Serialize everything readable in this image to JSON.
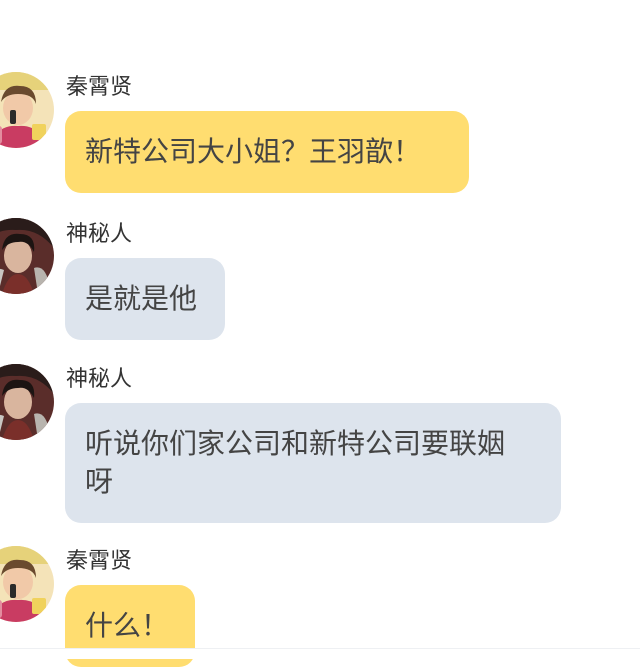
{
  "messages": [
    {
      "sender": "秦霄贤",
      "text": "新特公司大小姐？王羽歆！",
      "avatar": "person-avatar-icon",
      "color": "yellow"
    },
    {
      "sender": "神秘人",
      "text": "是就是他",
      "avatar": "anime-avatar-icon",
      "color": "blue"
    },
    {
      "sender": "神秘人",
      "text": "听说你们家公司和新特公司要联姻\n呀",
      "avatar": "anime-avatar-icon",
      "color": "blue"
    },
    {
      "sender": "秦霄贤",
      "text": "什么！",
      "avatar": "person-avatar-icon",
      "color": "yellow"
    }
  ],
  "colors": {
    "yellow_bubble": "#ffdd70",
    "blue_bubble": "#dde4ed",
    "text": "#444444"
  }
}
